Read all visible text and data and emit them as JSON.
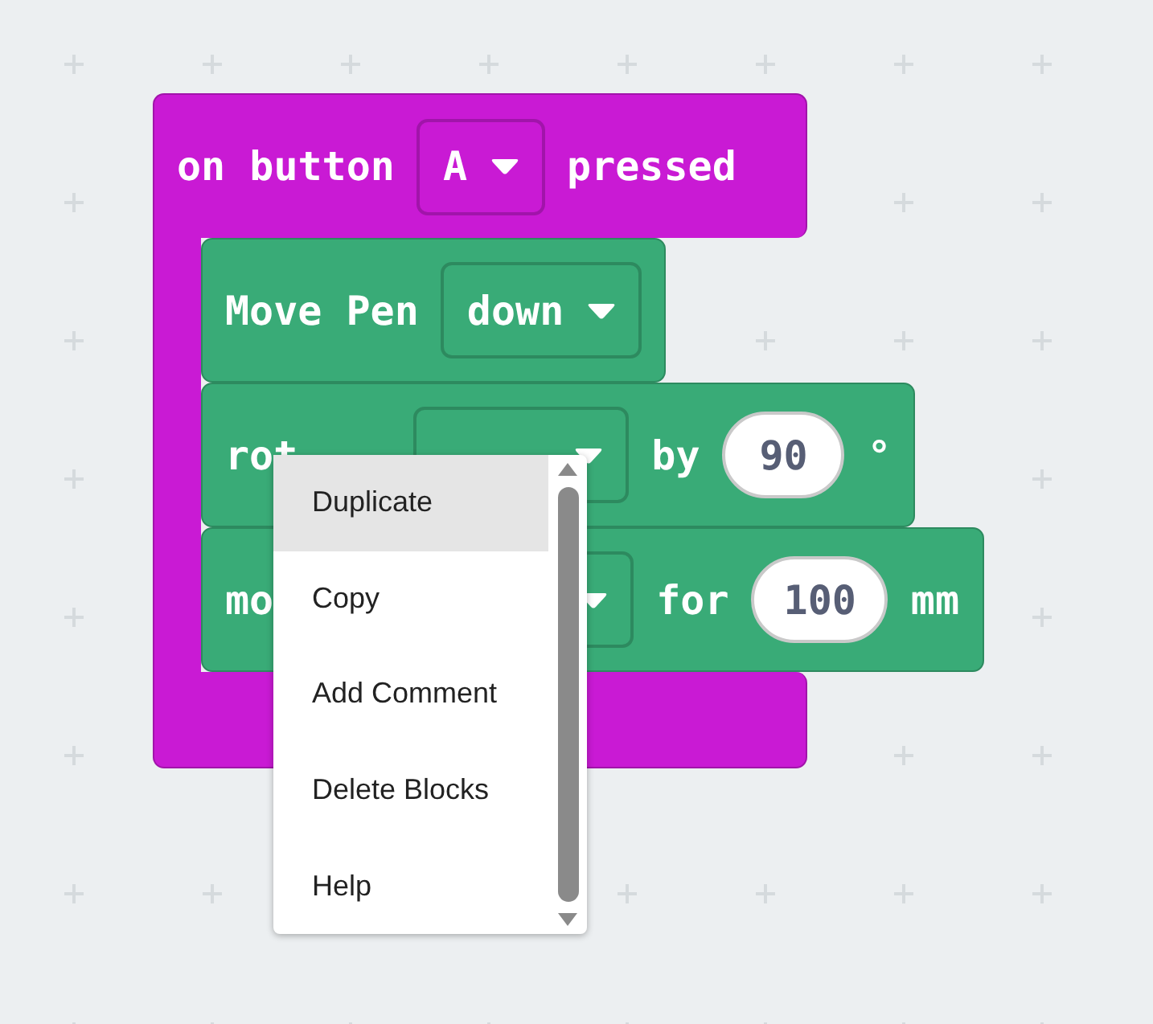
{
  "event_block": {
    "words": [
      {
        "kind": "text",
        "text": "on button"
      },
      {
        "kind": "dropdown",
        "text": "A"
      },
      {
        "kind": "text",
        "text": "pressed"
      }
    ]
  },
  "statements": [
    {
      "words": [
        {
          "kind": "text",
          "text": "Move Pen"
        },
        {
          "kind": "dropdown",
          "text": "down"
        }
      ]
    },
    {
      "words": [
        {
          "kind": "text",
          "text": "rot"
        },
        {
          "kind": "dropdown"
        },
        {
          "kind": "text",
          "text": "by"
        },
        {
          "kind": "number",
          "text": "90"
        },
        {
          "kind": "text",
          "text": "°"
        }
      ]
    },
    {
      "words": [
        {
          "kind": "text",
          "text": "mo"
        },
        {
          "kind": "dropdown"
        },
        {
          "kind": "text",
          "text": "for"
        },
        {
          "kind": "number",
          "text": "100"
        },
        {
          "kind": "text",
          "text": "mm"
        }
      ]
    }
  ],
  "context_menu": {
    "items": [
      {
        "label": "Duplicate",
        "selected": true
      },
      {
        "label": "Copy",
        "selected": false
      },
      {
        "label": "Add Comment",
        "selected": false
      },
      {
        "label": "Delete Blocks",
        "selected": false
      },
      {
        "label": "Help",
        "selected": false
      }
    ]
  }
}
